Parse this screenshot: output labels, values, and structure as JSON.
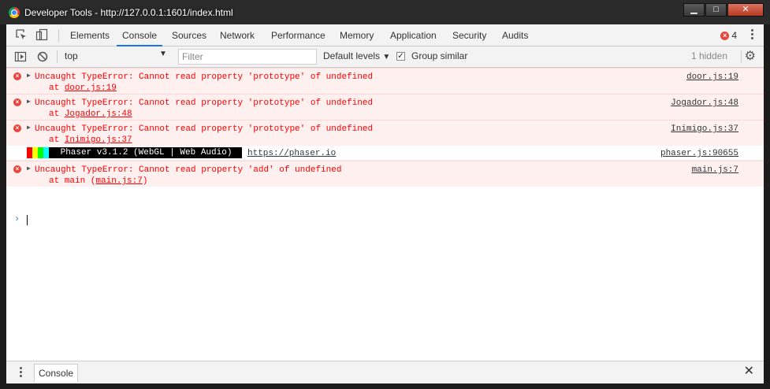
{
  "window": {
    "title": "Developer Tools - http://127.0.0.1:1601/index.html",
    "minimize": "▁",
    "maximize": "□",
    "close": "✕"
  },
  "tabs": [
    "Elements",
    "Console",
    "Sources",
    "Network",
    "Performance",
    "Memory",
    "Application",
    "Security",
    "Audits"
  ],
  "active_tab": "Console",
  "error_count": "4",
  "toolbar": {
    "context": "top",
    "filter_placeholder": "Filter",
    "levels_label": "Default levels",
    "group_similar": "Group similar",
    "group_similar_checked": true,
    "hidden_count": "1 hidden"
  },
  "messages": [
    {
      "type": "error",
      "text": "Uncaught TypeError: Cannot read property 'prototype' of undefined",
      "at": "door.js:19",
      "source": "door.js:19"
    },
    {
      "type": "error",
      "text": "Uncaught TypeError: Cannot read property 'prototype' of undefined",
      "at": "Jogador.js:48",
      "source": "Jogador.js:48"
    },
    {
      "type": "error",
      "text": "Uncaught TypeError: Cannot read property 'prototype' of undefined",
      "at": "Inimigo.js:37",
      "source": "Inimigo.js:37"
    },
    {
      "type": "log",
      "banner": " Phaser v3.1.2 (WebGL | Web Audio) ",
      "url": "https://phaser.io",
      "source": "phaser.js:90655",
      "stripe_colors": [
        "#ff0000",
        "#ffff00",
        "#00ff00",
        "#00ffff"
      ]
    },
    {
      "type": "error",
      "text": "Uncaught TypeError: Cannot read property 'add' of undefined",
      "at_prefix": "at main (",
      "at": "main.js:7",
      "at_suffix": ")",
      "source": "main.js:7"
    }
  ],
  "at_label": "at",
  "prompt": "›",
  "drawer": {
    "tab": "Console"
  }
}
